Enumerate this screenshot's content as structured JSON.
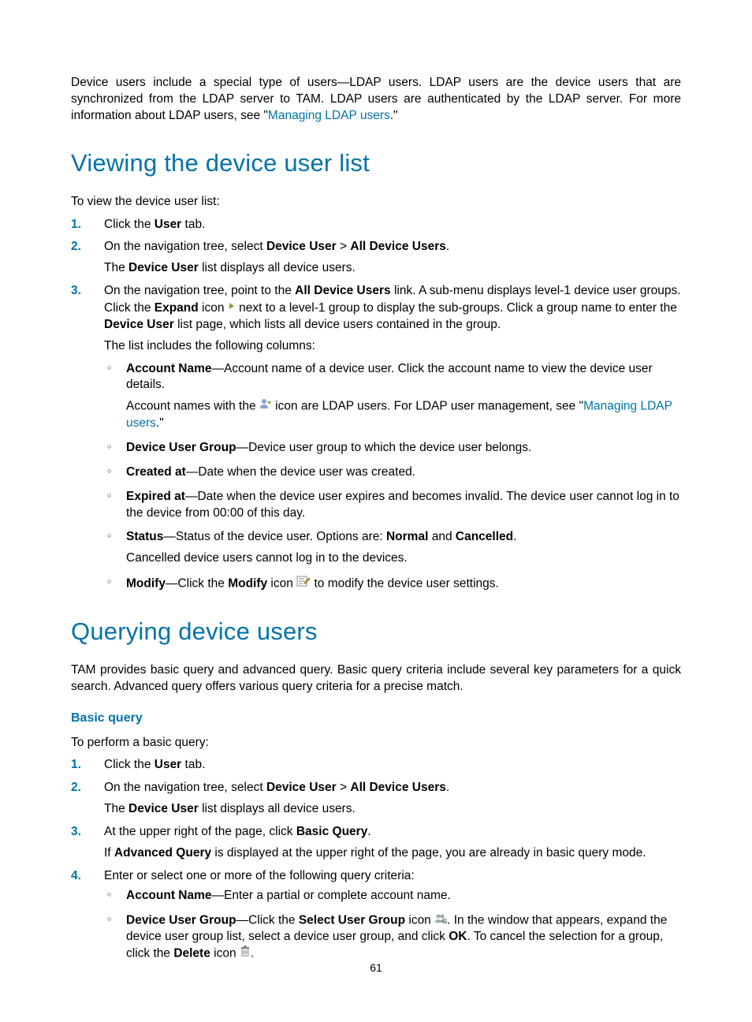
{
  "intro": {
    "p1_a": "Device users include a special type of users—LDAP users. LDAP users are the device users that are synchronized from the LDAP server to TAM. LDAP users are authenticated by the LDAP server. For more information about LDAP users, see \"",
    "p1_link": "Managing LDAP users",
    "p1_b": ".\""
  },
  "section1": {
    "heading": "Viewing the device user list",
    "lead": "To view the device user list:",
    "steps": {
      "s1": {
        "num": "1.",
        "t1": "Click the ",
        "b1": "User",
        "t2": " tab."
      },
      "s2": {
        "num": "2.",
        "t1": "On the navigation tree, select ",
        "b1": "Device User",
        "t2": " > ",
        "b2": "All Device Users",
        "t3": ".",
        "sub_t1": "The ",
        "sub_b1": "Device User",
        "sub_t2": " list displays all device users."
      },
      "s3": {
        "num": "3.",
        "t1": "On the navigation tree, point to the ",
        "b1": "All Device Users",
        "t2": " link. A sub-menu displays level-1 device user groups. Click the ",
        "b2": "Expand",
        "t3": " icon ",
        "t4": " next to a level-1 group to display the sub-groups. Click a group name to enter the ",
        "b3": "Device User",
        "t5": " list page, which lists all device users contained in the group.",
        "sub1": "The list includes the following columns:",
        "items": {
          "i1": {
            "b": "Account Name",
            "t": "—Account name of a device user. Click the account name to view the device user details.",
            "sub_t1": "Account names with the ",
            "sub_t2": " icon are LDAP users. For LDAP user management, see \"",
            "sub_link": "Managing LDAP users",
            "sub_t3": ".\""
          },
          "i2": {
            "b": "Device User Group",
            "t": "—Device user group to which the device user belongs."
          },
          "i3": {
            "b": "Created at",
            "t": "—Date when the device user was created."
          },
          "i4": {
            "b": "Expired at",
            "t": "—Date when the device user expires and becomes invalid. The device user cannot log in to the device from 00:00 of this day."
          },
          "i5": {
            "b": "Status",
            "t1": "—Status of the device user. Options are: ",
            "b2": "Normal",
            "t2": " and ",
            "b3": "Cancelled",
            "t3": ".",
            "sub": "Cancelled device users cannot log in to the devices."
          },
          "i6": {
            "b": "Modify",
            "t1": "—Click the ",
            "b2": "Modify",
            "t2": " icon ",
            "t3": " to modify the device user settings."
          }
        }
      }
    }
  },
  "section2": {
    "heading": "Querying device users",
    "lead": "TAM provides basic query and advanced query. Basic query criteria include several key parameters for a quick search. Advanced query offers various query criteria for a precise match.",
    "sub_heading": "Basic query",
    "lead2": "To perform a basic query:",
    "steps": {
      "s1": {
        "num": "1.",
        "t1": "Click the ",
        "b1": "User",
        "t2": " tab."
      },
      "s2": {
        "num": "2.",
        "t1": "On the navigation tree, select ",
        "b1": "Device User",
        "t2": " > ",
        "b2": "All Device Users",
        "t3": ".",
        "sub_t1": "The ",
        "sub_b1": "Device User",
        "sub_t2": " list displays all device users."
      },
      "s3": {
        "num": "3.",
        "t1": "At the upper right of the page, click ",
        "b1": "Basic Query",
        "t2": ".",
        "sub_t1": "If ",
        "sub_b1": "Advanced Query",
        "sub_t2": " is displayed at the upper right of the page, you are already in basic query mode."
      },
      "s4": {
        "num": "4.",
        "t1": "Enter or select one or more of the following query criteria:",
        "items": {
          "i1": {
            "b": "Account Name",
            "t": "—Enter a partial or complete account name."
          },
          "i2": {
            "b": "Device User Group",
            "t1": "—Click the ",
            "b2": "Select User Group",
            "t2": " icon ",
            "t3": ". In the window that appears, expand the device user group list, select a device user group, and click ",
            "b3": "OK",
            "t4": ". To cancel the selection for a group, click the ",
            "b4": "Delete",
            "t5": " icon ",
            "t6": "."
          }
        }
      }
    }
  },
  "page_number": "61"
}
